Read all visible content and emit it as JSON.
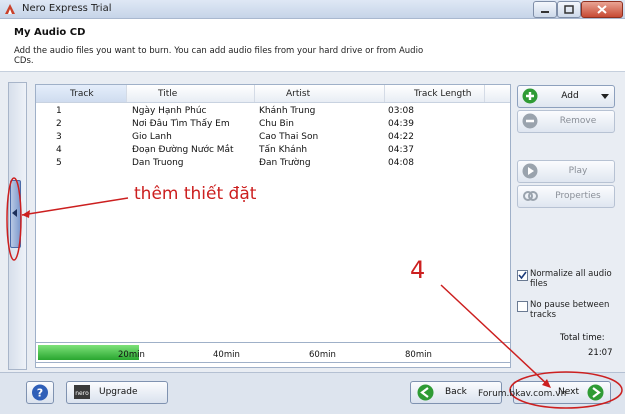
{
  "window": {
    "title": "Nero Express Trial"
  },
  "header": {
    "title": "My Audio CD",
    "description": "Add the audio files you want to burn. You can add audio files from your hard drive or from Audio CDs."
  },
  "tracklist": {
    "columns": [
      "Track",
      "Title",
      "Artist",
      "Track Length"
    ],
    "rows": [
      [
        "1",
        "Ngày Hạnh Phúc",
        "Khánh Trung",
        "03:08"
      ],
      [
        "2",
        "Nơi Đâu Tìm Thấy Em",
        "Chu Bin",
        "04:39"
      ],
      [
        "3",
        "Gio Lanh",
        "Cao Thai Son",
        "04:22"
      ],
      [
        "4",
        "Đoạn Đường Nước Mắt",
        "Tấn  Khánh",
        "04:37"
      ],
      [
        "5",
        "Dan Truong",
        "Đan Trường",
        "04:08"
      ]
    ]
  },
  "side_buttons": {
    "add": "Add",
    "remove": "Remove",
    "play": "Play",
    "properties": "Properties"
  },
  "options": {
    "normalize": {
      "label": "Normalize all audio files",
      "checked": true
    },
    "no_pause": {
      "label": "No pause between tracks",
      "checked": false
    }
  },
  "total": {
    "label": "Total time:",
    "value": "21:07"
  },
  "capacity": {
    "marks": [
      "20min",
      "40min",
      "60min",
      "80min"
    ],
    "fill_minutes": 21.1
  },
  "bottom": {
    "upgrade": "Upgrade",
    "back": "Back",
    "next": "Next"
  },
  "annotations": {
    "side_note": "thêm thiết đặt",
    "step": "4",
    "watermark": "Forum.bkav.com.vn",
    "color": "#cc1f1f"
  },
  "colors": {
    "accent": "#29a630",
    "window": "#e9edf3"
  }
}
